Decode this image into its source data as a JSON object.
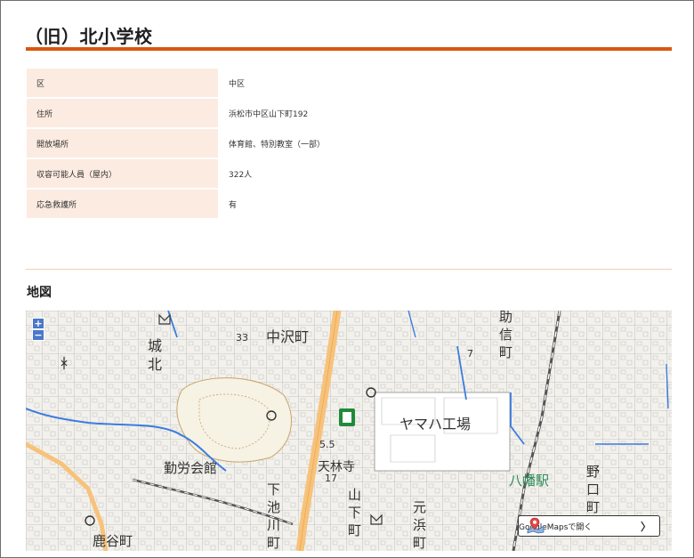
{
  "page": {
    "title": "（旧）北小学校"
  },
  "info": {
    "rows": [
      {
        "label": "区",
        "value": "中区"
      },
      {
        "label": "住所",
        "value": "浜松市中区山下町192"
      },
      {
        "label": "開放場所",
        "value": "体育館、特別教室（一部）"
      },
      {
        "label": "収容可能人員（屋内）",
        "value": "322人"
      },
      {
        "label": "応急救護所",
        "value": "有"
      }
    ]
  },
  "map_section": {
    "heading": "地図",
    "zoom_in": "+",
    "zoom_out": "−",
    "labels": {
      "nakazawa": "中沢町",
      "yamaha": "ヤマハ工場",
      "kinro": "勤労会館",
      "tenrinji": "天林寺",
      "hachiman": "八幡駅",
      "kitagawa": "鹿谷町",
      "shiro": "城",
      "kita": "北",
      "yamashita": "山",
      "yamashita2": "下",
      "yamashita3": "町",
      "shimoike": "下",
      "shimoike2": "池",
      "shimoike3": "川",
      "shimoike4": "町",
      "motohama": "元",
      "motohama2": "浜",
      "motohama3": "町",
      "noguchi": "野",
      "noguchi2": "口",
      "noguchi3": "町",
      "sukenobu": "助",
      "sukenobu2": "信",
      "sukenobu3": "町",
      "elev1": "33",
      "elev2": "5.5",
      "elev3": "17",
      "elev4": "7"
    },
    "google_button": {
      "label": "GoogleMapsで開く",
      "chevron": "〉"
    }
  },
  "colors": {
    "accent": "#d9560f",
    "table_key_bg": "#fcebe1",
    "divider": "#f1cdb5",
    "map_road_major": "#f7c27a",
    "map_water": "#3b7ce0"
  }
}
